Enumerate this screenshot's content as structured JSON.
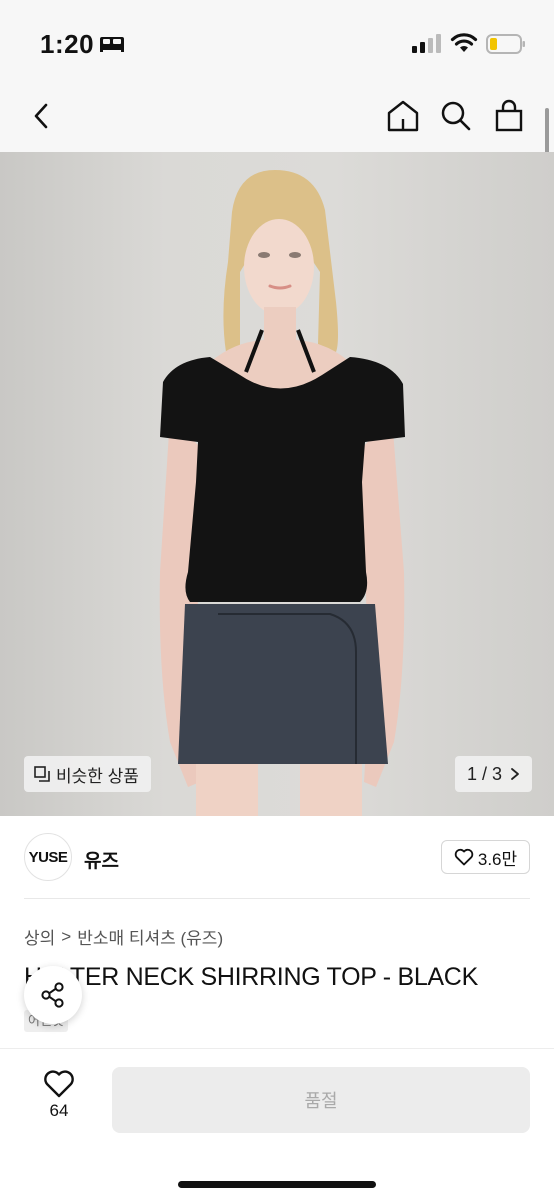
{
  "status": {
    "time": "1:20"
  },
  "nav": {
    "back_icon": "chevron-left-icon",
    "home_icon": "home-icon",
    "search_icon": "search-icon",
    "bag_icon": "shopping-bag-icon"
  },
  "gallery": {
    "similar_label": "비슷한 상품",
    "page_indicator": "1 / 3"
  },
  "shop": {
    "logo_text": "YUSE",
    "name": "유즈",
    "likes": "3.6만"
  },
  "breadcrumb": {
    "category": "상의",
    "separator": ">",
    "subcategory": "반소매 티셔츠 (유즈)"
  },
  "product": {
    "title": "HALTER NECK SHIRRING TOP - BLACK",
    "tag": "어떤것"
  },
  "bottom": {
    "wish_count": "64",
    "soldout_label": "품절"
  },
  "colors": {
    "accent": "#111111",
    "soldout_bg": "#ececec",
    "soldout_text": "#a9a9a9"
  }
}
